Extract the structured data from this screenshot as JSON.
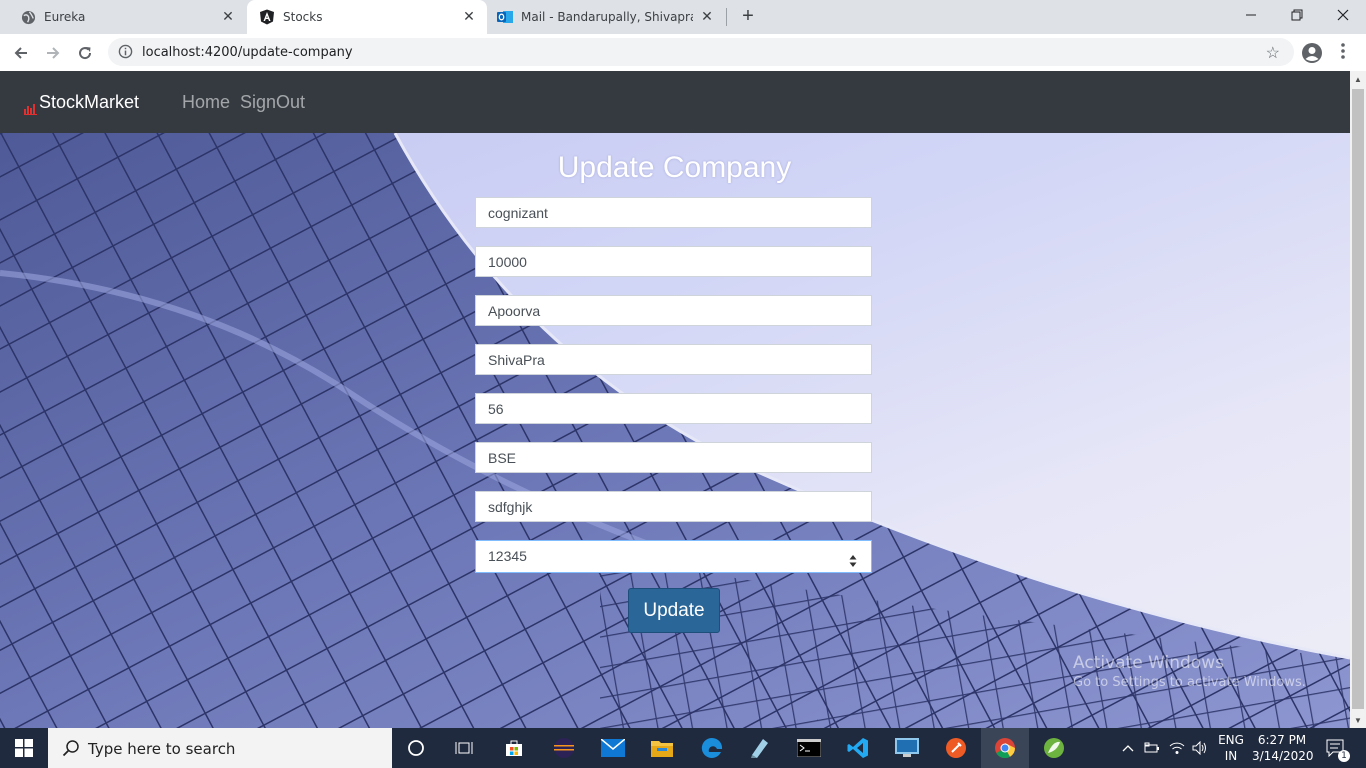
{
  "browser": {
    "tabs": [
      {
        "title": "Eureka",
        "icon": "globe-icon"
      },
      {
        "title": "Stocks",
        "icon": "angular-icon"
      },
      {
        "title": "Mail - Bandarupally, Shivaprasad",
        "icon": "outlook-icon"
      }
    ],
    "active_tab": 1,
    "url": "localhost:4200/update-company"
  },
  "app": {
    "brand": "StockMarket",
    "nav": {
      "home": "Home",
      "signout": "SignOut"
    }
  },
  "form": {
    "title": "Update Company",
    "fields": [
      {
        "value": "cognizant"
      },
      {
        "value": "10000"
      },
      {
        "value": "Apoorva"
      },
      {
        "value": "ShivaPra"
      },
      {
        "value": "56"
      },
      {
        "value": "BSE"
      },
      {
        "value": "sdfghjk"
      },
      {
        "value": "12345",
        "type": "number"
      }
    ],
    "submit_label": "Update"
  },
  "watermark": {
    "line1": "Activate Windows",
    "line2": "Go to Settings to activate Windows."
  },
  "taskbar": {
    "search_placeholder": "Type here to search",
    "language": {
      "line1": "ENG",
      "line2": "IN"
    },
    "time": "6:27 PM",
    "date": "3/14/2020",
    "notification_count": "1"
  },
  "colors": {
    "navbar": "#343a40",
    "button": "#2a6698",
    "taskbar": "#1f2a3e"
  }
}
